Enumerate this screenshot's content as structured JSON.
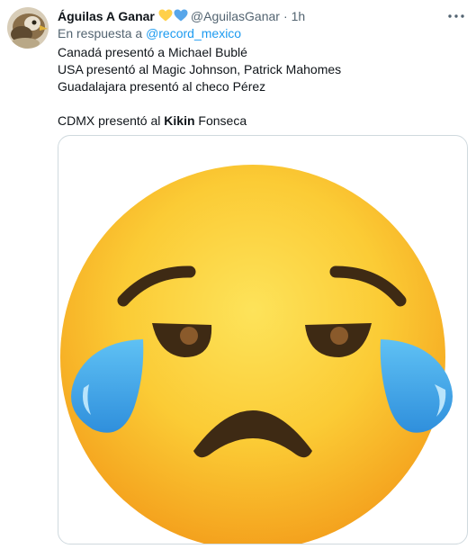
{
  "tweet": {
    "display_name": "Águilas A Ganar",
    "badge_icons": [
      "yellow-heart-icon",
      "blue-heart-icon"
    ],
    "handle": "@AguilasGanar",
    "separator": "·",
    "time": "1h",
    "reply_prefix": "En respuesta a ",
    "reply_to": "@record_mexico",
    "lines": [
      "Canadá presentó a Michael Bublé",
      "USA presentó al Magic Johnson, Patrick Mahomes",
      "Guadalajara presentó al checo Pérez"
    ],
    "last_line_prefix": "CDMX presentó al ",
    "last_line_bold": "Kikin",
    "last_line_suffix": " Fonseca",
    "media_icon": "crying-face-emoji"
  },
  "colors": {
    "link": "#1d9bf0",
    "secondary_text": "#536471",
    "primary_text": "#0f1419",
    "heart_yellow": "#ffd04a",
    "heart_blue": "#58a6ea"
  }
}
